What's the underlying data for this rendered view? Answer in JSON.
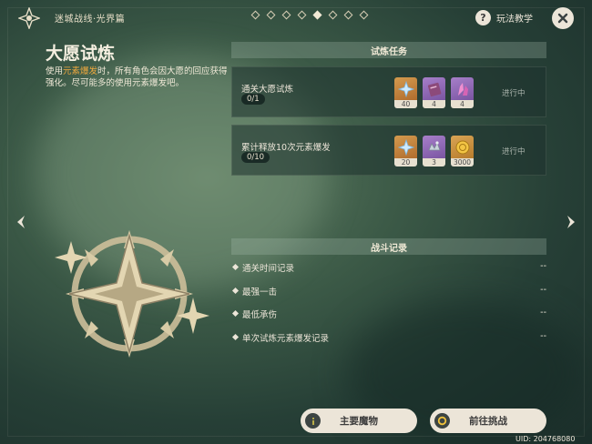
{
  "header": {
    "mode_title": "迷城战线·光界篇",
    "page_count": 8,
    "active_page_index": 4,
    "help_label": "玩法教学"
  },
  "challenge": {
    "title": "大愿试炼",
    "desc_prefix": "使用",
    "desc_highlight": "元素爆发",
    "desc_suffix": "时，所有角色会因大愿的回应获得强化。尽可能多的使用元素爆发吧。"
  },
  "tasks": {
    "header": "试炼任务",
    "items": [
      {
        "name": "通关大愿试炼",
        "progress": "0/1",
        "status": "进行中",
        "rewards": [
          {
            "icon": "primogem-icon",
            "qty": "40"
          },
          {
            "icon": "hero-wit-book-icon",
            "qty": "4"
          },
          {
            "icon": "enhancement-ore-icon",
            "qty": "4"
          }
        ]
      },
      {
        "name": "累计释放10次元素爆发",
        "progress": "0/10",
        "status": "进行中",
        "rewards": [
          {
            "icon": "primogem-icon",
            "qty": "20"
          },
          {
            "icon": "crown-ore-icon",
            "qty": "3"
          },
          {
            "icon": "mora-coin-icon",
            "qty": "3000"
          }
        ]
      }
    ]
  },
  "records": {
    "header": "战斗记录",
    "items": [
      {
        "label": "通关时间记录",
        "value": "--"
      },
      {
        "label": "最强一击",
        "value": "--"
      },
      {
        "label": "最低承伤",
        "value": "--"
      },
      {
        "label": "单次试炼元素爆发记录",
        "value": "--"
      }
    ]
  },
  "buttons": {
    "enemies_label": "主要魔物",
    "challenge_label": "前往挑战"
  },
  "uid": "UID: 204768080",
  "colors": {
    "accent_orange": "#f0a93e",
    "panel_cream": "#ece5d8",
    "status_gray": "#a9b3ab"
  }
}
